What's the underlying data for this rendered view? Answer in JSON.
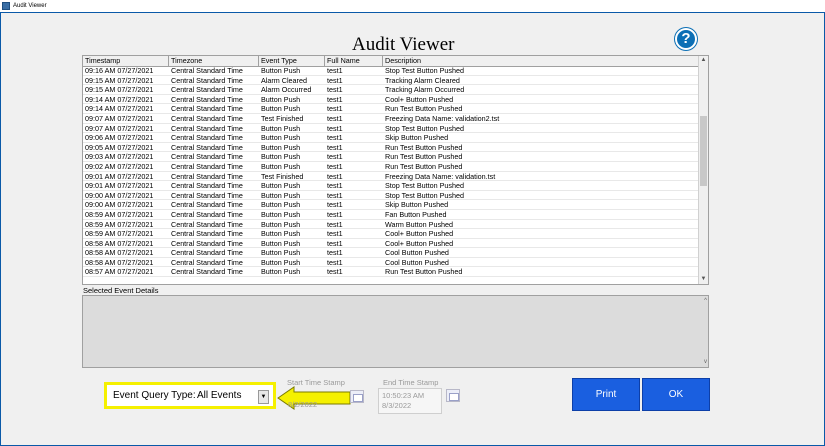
{
  "window": {
    "title": "Audit Viewer"
  },
  "heading": "Audit Viewer",
  "help_icon": "?",
  "table": {
    "columns": [
      "Timestamp",
      "Timezone",
      "Event Type",
      "Full Name",
      "Description"
    ],
    "rows": [
      [
        "09:16 AM  07/27/2021",
        "Central Standard Time",
        "Button Push",
        "test1",
        "Stop Test Button Pushed"
      ],
      [
        "09:15 AM  07/27/2021",
        "Central Standard Time",
        "Alarm Cleared",
        "test1",
        "Tracking Alarm Cleared"
      ],
      [
        "09:15 AM  07/27/2021",
        "Central Standard Time",
        "Alarm Occurred",
        "test1",
        "Tracking Alarm Occurred"
      ],
      [
        "09:14 AM  07/27/2021",
        "Central Standard Time",
        "Button Push",
        "test1",
        "Cool+ Button Pushed"
      ],
      [
        "09:14 AM  07/27/2021",
        "Central Standard Time",
        "Button Push",
        "test1",
        "Run Test Button Pushed"
      ],
      [
        "09:07 AM  07/27/2021",
        "Central Standard Time",
        "Test Finished",
        "test1",
        "Freezing Data Name: validation2.tst"
      ],
      [
        "09:07 AM  07/27/2021",
        "Central Standard Time",
        "Button Push",
        "test1",
        "Stop Test Button Pushed"
      ],
      [
        "09:06 AM  07/27/2021",
        "Central Standard Time",
        "Button Push",
        "test1",
        "Skip Button Pushed"
      ],
      [
        "09:05 AM  07/27/2021",
        "Central Standard Time",
        "Button Push",
        "test1",
        "Run Test Button Pushed"
      ],
      [
        "09:03 AM  07/27/2021",
        "Central Standard Time",
        "Button Push",
        "test1",
        "Run Test Button Pushed"
      ],
      [
        "09:02 AM  07/27/2021",
        "Central Standard Time",
        "Button Push",
        "test1",
        "Run Test Button Pushed"
      ],
      [
        "09:01 AM  07/27/2021",
        "Central Standard Time",
        "Test Finished",
        "test1",
        "Freezing Data Name: validation.tst"
      ],
      [
        "09:01 AM  07/27/2021",
        "Central Standard Time",
        "Button Push",
        "test1",
        "Stop Test Button Pushed"
      ],
      [
        "09:00 AM  07/27/2021",
        "Central Standard Time",
        "Button Push",
        "test1",
        "Stop Test Button Pushed"
      ],
      [
        "09:00 AM  07/27/2021",
        "Central Standard Time",
        "Button Push",
        "test1",
        "Skip Button Pushed"
      ],
      [
        "08:59 AM  07/27/2021",
        "Central Standard Time",
        "Button Push",
        "test1",
        "Fan Button Pushed"
      ],
      [
        "08:59 AM  07/27/2021",
        "Central Standard Time",
        "Button Push",
        "test1",
        "Warm Button Pushed"
      ],
      [
        "08:59 AM  07/27/2021",
        "Central Standard Time",
        "Button Push",
        "test1",
        "Cool+ Button Pushed"
      ],
      [
        "08:58 AM  07/27/2021",
        "Central Standard Time",
        "Button Push",
        "test1",
        "Cool+ Button Pushed"
      ],
      [
        "08:58 AM  07/27/2021",
        "Central Standard Time",
        "Button Push",
        "test1",
        "Cool Button Pushed"
      ],
      [
        "08:58 AM  07/27/2021",
        "Central Standard Time",
        "Button Push",
        "test1",
        "Cool Button Pushed"
      ],
      [
        "08:57 AM  07/27/2021",
        "Central Standard Time",
        "Button Push",
        "test1",
        "Run Test Button Pushed"
      ]
    ]
  },
  "details": {
    "label": "Selected Event Details"
  },
  "query": {
    "label": "Event Query Type:",
    "value": "All Events"
  },
  "start": {
    "label": "Start Time Stamp",
    "date": "8/2/2022"
  },
  "end": {
    "label": "End Time Stamp",
    "time": "10:50:23 AM",
    "date": "8/3/2022"
  },
  "buttons": {
    "print": "Print",
    "ok": "OK"
  },
  "colors": {
    "accent": "#1a5fe0",
    "highlight": "#f5f000",
    "frame": "#0a59a8"
  }
}
